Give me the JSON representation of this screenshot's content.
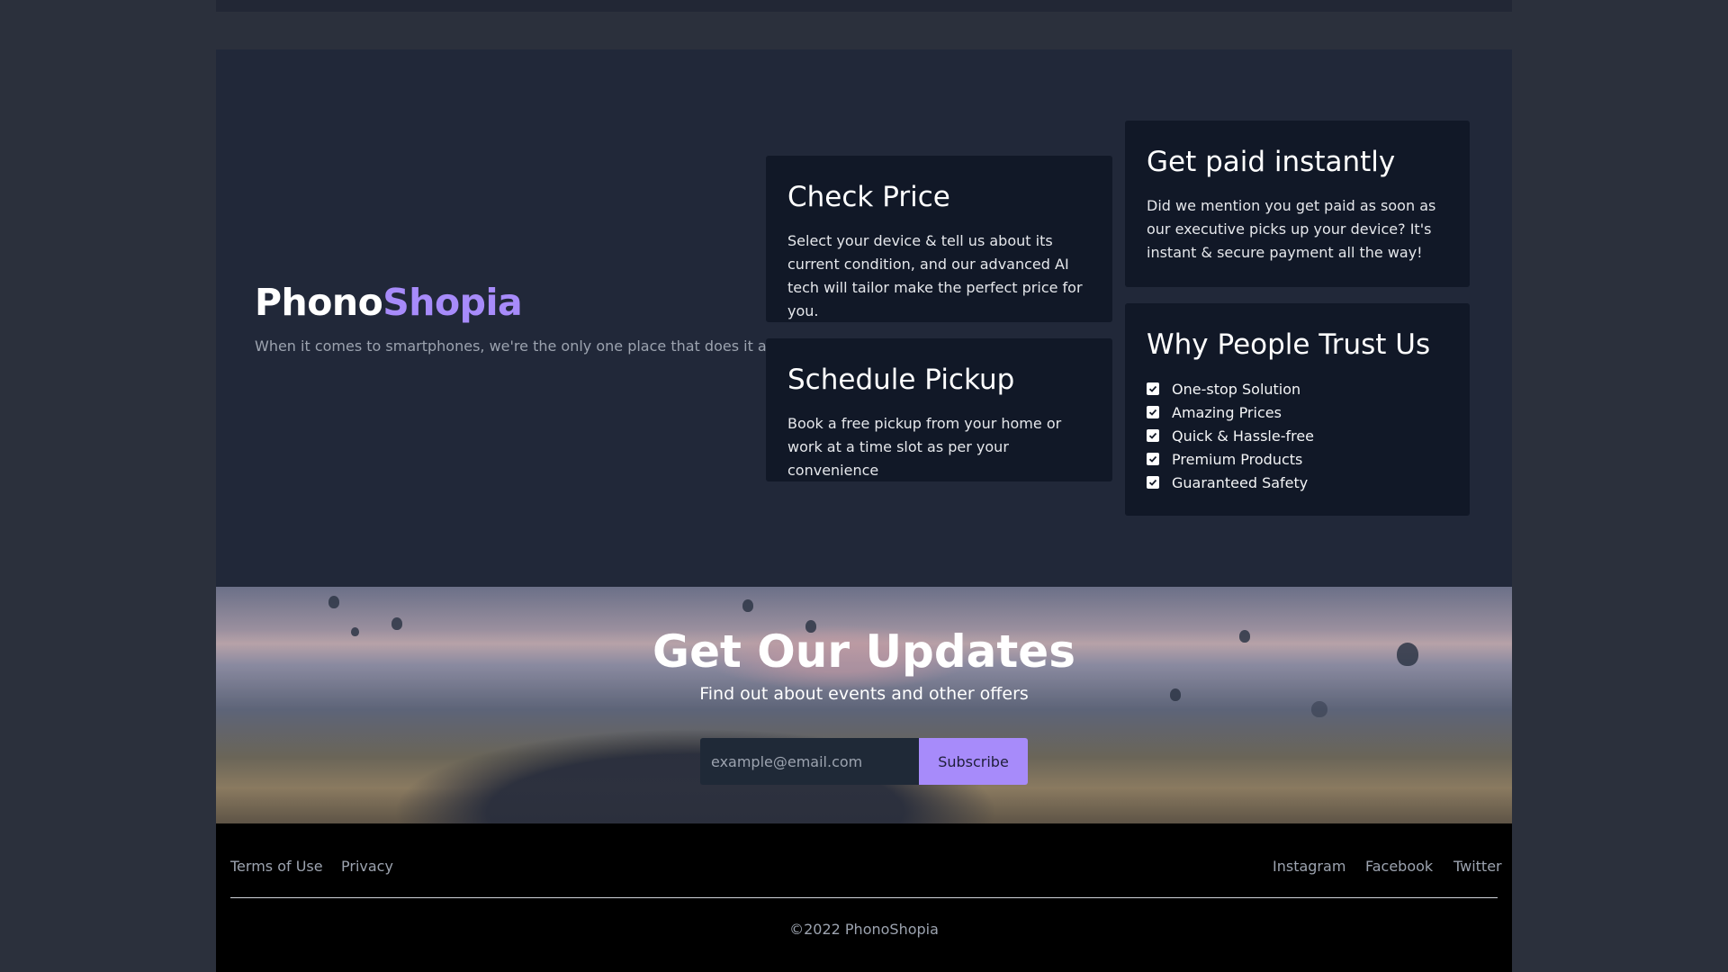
{
  "brand": {
    "name_part1": "Phono",
    "name_part2": "Shopia",
    "accent_color": "#a78bfa"
  },
  "tagline": "When it comes to smartphones, we're the only one place that does it all.",
  "cards": {
    "check_price": {
      "title": "Check Price",
      "text": "Select your device & tell us about its current condition, and our advanced AI tech will tailor make the perfect price for you."
    },
    "schedule_pickup": {
      "title": "Schedule Pickup",
      "text": "Book a free pickup from your home or work at a time slot as per your convenience"
    },
    "get_paid": {
      "title": "Get paid instantly",
      "text": "Did we mention you get paid as soon as our executive picks up your device? It's instant & secure payment all the way!"
    },
    "trust": {
      "title": "Why People Trust Us",
      "items": [
        "One-stop Solution",
        "Amazing Prices",
        "Quick & Hassle-free",
        "Premium Products",
        "Guaranteed Safety"
      ],
      "icon": "checkbox-checked-icon"
    }
  },
  "updates": {
    "title": "Get Our Updates",
    "subtitle": "Find out about events and other offers",
    "email_placeholder": "example@email.com",
    "subscribe_label": "Subscribe"
  },
  "footer": {
    "links_left": [
      "Terms of Use",
      "Privacy"
    ],
    "links_right": [
      "Instagram",
      "Facebook",
      "Twitter"
    ],
    "copyright": "©2022 PhonoShopia"
  }
}
